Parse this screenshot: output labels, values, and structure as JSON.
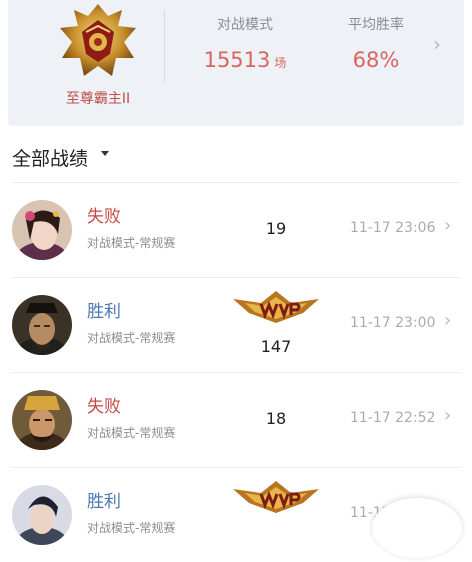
{
  "summary": {
    "rank_name": "至尊霸主II",
    "mode_label": "对战模式",
    "mode_value": "15513",
    "mode_unit": "场",
    "winrate_label": "平均胜率",
    "winrate_value": "68%"
  },
  "section": {
    "title": "全部战绩"
  },
  "matches": [
    {
      "result": "失败",
      "mode": "对战模式-常规赛",
      "kda": "19",
      "time": "11-17 23:06",
      "mvp": false
    },
    {
      "result": "胜利",
      "mode": "对战模式-常规赛",
      "kda": "147",
      "time": "11-17 23:00",
      "mvp": true
    },
    {
      "result": "失败",
      "mode": "对战模式-常规赛",
      "kda": "18",
      "time": "11-17 22:52",
      "mvp": false
    },
    {
      "result": "胜利",
      "mode": "对战模式-常规赛",
      "kda": "",
      "time": "11-17",
      "mvp": true
    }
  ],
  "colors": {
    "lose": "#c84a45",
    "win": "#4a78b5",
    "stat": "#d9655f"
  }
}
